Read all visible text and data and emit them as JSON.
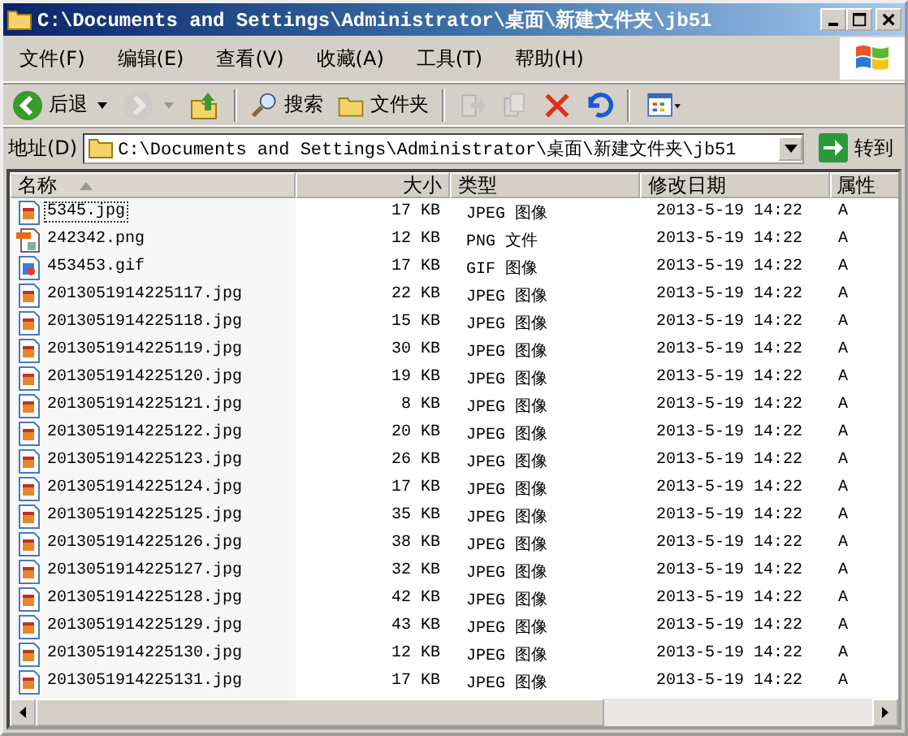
{
  "window": {
    "title": "C:\\Documents and Settings\\Administrator\\桌面\\新建文件夹\\jb51"
  },
  "menu": [
    "文件(F)",
    "编辑(E)",
    "查看(V)",
    "收藏(A)",
    "工具(T)",
    "帮助(H)"
  ],
  "toolbar": [
    {
      "kind": "back",
      "label": "后退",
      "disabled": false
    },
    {
      "kind": "forward",
      "disabled": true
    },
    {
      "kind": "up",
      "disabled": false
    },
    {
      "kind": "search",
      "label": "搜索",
      "disabled": false
    },
    {
      "kind": "folders",
      "label": "文件夹",
      "disabled": false
    },
    {
      "kind": "move",
      "disabled": true
    },
    {
      "kind": "copy",
      "disabled": true
    },
    {
      "kind": "delete",
      "disabled": false
    },
    {
      "kind": "undo",
      "disabled": false
    },
    {
      "kind": "views",
      "disabled": false
    }
  ],
  "address": {
    "label": "地址(D)",
    "value": "C:\\Documents and Settings\\Administrator\\桌面\\新建文件夹\\jb51",
    "go": "转到"
  },
  "columns": [
    {
      "label": "名称",
      "sorted": true
    },
    {
      "label": "大小",
      "sorted": false
    },
    {
      "label": "类型",
      "sorted": false
    },
    {
      "label": "修改日期",
      "sorted": false
    },
    {
      "label": "属性",
      "sorted": false
    }
  ],
  "rows": [
    {
      "kind": "jpg",
      "name": "5345.jpg",
      "size": "17 KB",
      "type": "JPEG 图像",
      "date": "2013-5-19 14:22",
      "attr": "A",
      "focused": true
    },
    {
      "kind": "png",
      "name": "242342.png",
      "size": "12 KB",
      "type": "PNG 文件",
      "date": "2013-5-19 14:22",
      "attr": "A",
      "focused": false
    },
    {
      "kind": "gif",
      "name": "453453.gif",
      "size": "17 KB",
      "type": "GIF 图像",
      "date": "2013-5-19 14:22",
      "attr": "A",
      "focused": false
    },
    {
      "kind": "jpg",
      "name": "2013051914225117.jpg",
      "size": "22 KB",
      "type": "JPEG 图像",
      "date": "2013-5-19 14:22",
      "attr": "A",
      "focused": false
    },
    {
      "kind": "jpg",
      "name": "2013051914225118.jpg",
      "size": "15 KB",
      "type": "JPEG 图像",
      "date": "2013-5-19 14:22",
      "attr": "A",
      "focused": false
    },
    {
      "kind": "jpg",
      "name": "2013051914225119.jpg",
      "size": "30 KB",
      "type": "JPEG 图像",
      "date": "2013-5-19 14:22",
      "attr": "A",
      "focused": false
    },
    {
      "kind": "jpg",
      "name": "2013051914225120.jpg",
      "size": "19 KB",
      "type": "JPEG 图像",
      "date": "2013-5-19 14:22",
      "attr": "A",
      "focused": false
    },
    {
      "kind": "jpg",
      "name": "2013051914225121.jpg",
      "size": "8 KB",
      "type": "JPEG 图像",
      "date": "2013-5-19 14:22",
      "attr": "A",
      "focused": false
    },
    {
      "kind": "jpg",
      "name": "2013051914225122.jpg",
      "size": "20 KB",
      "type": "JPEG 图像",
      "date": "2013-5-19 14:22",
      "attr": "A",
      "focused": false
    },
    {
      "kind": "jpg",
      "name": "2013051914225123.jpg",
      "size": "26 KB",
      "type": "JPEG 图像",
      "date": "2013-5-19 14:22",
      "attr": "A",
      "focused": false
    },
    {
      "kind": "jpg",
      "name": "2013051914225124.jpg",
      "size": "17 KB",
      "type": "JPEG 图像",
      "date": "2013-5-19 14:22",
      "attr": "A",
      "focused": false
    },
    {
      "kind": "jpg",
      "name": "2013051914225125.jpg",
      "size": "35 KB",
      "type": "JPEG 图像",
      "date": "2013-5-19 14:22",
      "attr": "A",
      "focused": false
    },
    {
      "kind": "jpg",
      "name": "2013051914225126.jpg",
      "size": "38 KB",
      "type": "JPEG 图像",
      "date": "2013-5-19 14:22",
      "attr": "A",
      "focused": false
    },
    {
      "kind": "jpg",
      "name": "2013051914225127.jpg",
      "size": "32 KB",
      "type": "JPEG 图像",
      "date": "2013-5-19 14:22",
      "attr": "A",
      "focused": false
    },
    {
      "kind": "jpg",
      "name": "2013051914225128.jpg",
      "size": "42 KB",
      "type": "JPEG 图像",
      "date": "2013-5-19 14:22",
      "attr": "A",
      "focused": false
    },
    {
      "kind": "jpg",
      "name": "2013051914225129.jpg",
      "size": "43 KB",
      "type": "JPEG 图像",
      "date": "2013-5-19 14:22",
      "attr": "A",
      "focused": false
    },
    {
      "kind": "jpg",
      "name": "2013051914225130.jpg",
      "size": "12 KB",
      "type": "JPEG 图像",
      "date": "2013-5-19 14:22",
      "attr": "A",
      "focused": false
    },
    {
      "kind": "jpg",
      "name": "2013051914225131.jpg",
      "size": "17 KB",
      "type": "JPEG 图像",
      "date": "2013-5-19 14:22",
      "attr": "A",
      "focused": false
    }
  ]
}
